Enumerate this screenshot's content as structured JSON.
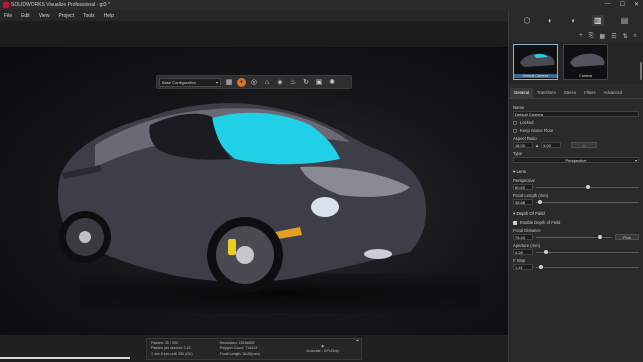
{
  "app": {
    "title": "SOLIDWORKS Visualize Professional - gt3 *",
    "window_controls": [
      "—",
      "☐",
      "✕"
    ]
  },
  "menu": [
    "File",
    "Edit",
    "View",
    "Project",
    "Tools",
    "Help"
  ],
  "viewport_toolbar": {
    "configuration": "Base Configuration"
  },
  "status": {
    "passes": "Passes: 35 / 300",
    "passes_per_second": "Passes per second: 3.16",
    "time": "1 min 8 sec until 250 (OK)",
    "resolution": "Resolution: 1519x852",
    "polygon_count": "Polygon Count: 714414",
    "focal_length": "Focal Length: 38.88(mm)",
    "mode": "Accurate - GPUOnly"
  },
  "panel": {
    "thumbs": [
      {
        "label": "Default Camera",
        "selected": true
      },
      {
        "label": "Camera",
        "selected": false
      }
    ],
    "sub_tabs": [
      "General",
      "Transform",
      "Stereo",
      "Filters",
      "Advanced"
    ],
    "active_sub_tab": "General",
    "name_label": "Name",
    "name_value": "Default Camera",
    "locked_label": "Locked",
    "keep_above_floor_label": "Keep Above Floor",
    "aspect_label": "Aspect Ratio",
    "aspect_w": "16.00",
    "aspect_sep": "▲",
    "aspect_h": "9.00",
    "swap_label": "⇔",
    "type_label": "Type",
    "type_value": "Perspective",
    "lens_label": "Lens",
    "perspective_label": "Perspective",
    "perspective_value": "60.62",
    "focal_length_label": "Focal Length (mm)",
    "focal_length_value": "38.88",
    "dof_label": "Depth Of Field",
    "enable_dof_label": "Enable Depth of Field",
    "focal_distance_label": "Focal Distance",
    "focal_distance_value": "76.44",
    "pick_label": "Pick",
    "aperture_label": "Aperture (mm)",
    "aperture_value": "4.28",
    "fstop_label": "F Stop",
    "fstop_value": "1.41"
  },
  "sliders": {
    "perspective": 0.5,
    "focal_length": 0.04,
    "focal_distance": 0.84,
    "aperture": 0.1,
    "fstop": 0.05
  },
  "colors": {
    "accent_orange": "#d4792a",
    "selection_blue": "#3b6b8f",
    "windshield_cyan": "#1fd0e6",
    "car_body": "#45454f"
  }
}
